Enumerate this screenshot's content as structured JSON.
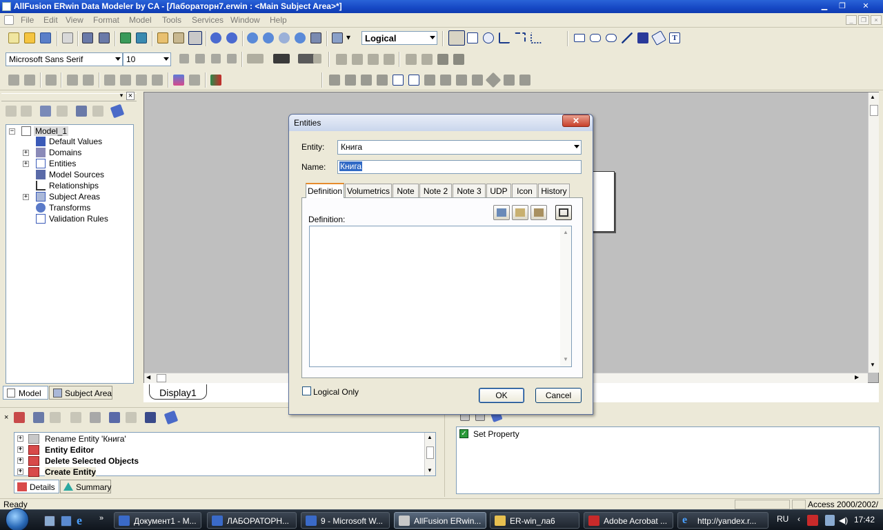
{
  "window": {
    "title": "AllFusion ERwin Data Modeler by CA - [Лабораторн7.erwin : <Main Subject Area>*]"
  },
  "menu": [
    "File",
    "Edit",
    "View",
    "Format",
    "Model",
    "Tools",
    "Services",
    "Window",
    "Help"
  ],
  "toolbar": {
    "model_type": "Logical",
    "font_name": "Microsoft Sans Serif",
    "font_size": "10"
  },
  "explorer": {
    "root": "Model_1",
    "items": [
      "Default Values",
      "Domains",
      "Entities",
      "Model Sources",
      "Relationships",
      "Subject Areas",
      "Transforms",
      "Validation Rules"
    ],
    "tabs": [
      "Model",
      "Subject Area"
    ]
  },
  "canvas": {
    "tab": "Display1"
  },
  "dialog": {
    "title": "Entities",
    "entity_label": "Entity:",
    "entity_value": "Книга",
    "name_label": "Name:",
    "name_value": "Книга",
    "tabs": [
      "Definition",
      "Volumetrics",
      "Note",
      "Note 2",
      "Note 3",
      "UDP",
      "Icon",
      "History"
    ],
    "definition_label": "Definition:",
    "definition_value": "",
    "logical_only_label": "Logical Only",
    "ok_label": "OK",
    "cancel_label": "Cancel"
  },
  "action_log": {
    "items": [
      "Rename Entity 'Книга'",
      "Entity Editor",
      "Delete Selected Objects",
      "Create Entity"
    ],
    "tabs": [
      "Details",
      "Summary"
    ],
    "property_item": "Set Property"
  },
  "status": {
    "text": "Ready",
    "db": "Access 2000/2002/"
  },
  "taskbar": {
    "tasks": [
      "Документ1 - M...",
      "ЛАБОРАТОРН...",
      "9 - Microsoft W...",
      "AllFusion ERwin...",
      "ER-win_ла6",
      "Adobe Acrobat ...",
      "http://yandex.r..."
    ],
    "lang": "RU",
    "clock": "17:42"
  },
  "colors": {
    "titlebar": "#1648c4",
    "selection": "#316ac5",
    "face": "#ece9d8"
  }
}
